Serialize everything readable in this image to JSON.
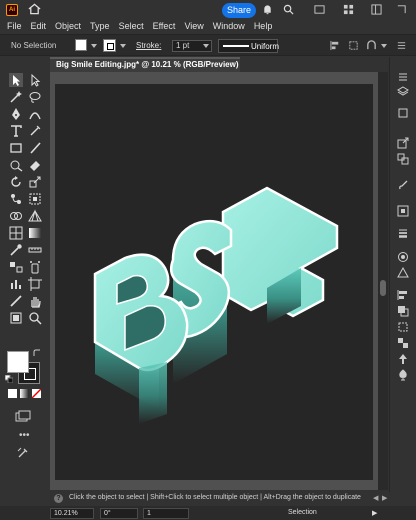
{
  "app": {
    "logo_text": "Ai",
    "share_label": "Share"
  },
  "menu": [
    "File",
    "Edit",
    "Object",
    "Type",
    "Select",
    "Effect",
    "View",
    "Window",
    "Help"
  ],
  "control_bar": {
    "selection_status": "No Selection",
    "stroke_label": "Stroke:",
    "stroke_weight": "1 pt",
    "stroke_profile": "Uniform"
  },
  "document": {
    "tab_title": "Big Smile Editing.jpg* @ 10.21 % (RGB/Preview)",
    "close_glyph": "×",
    "artwork_colors": {
      "face": "#8ee6d8",
      "side_top": "#55c2b3",
      "side_bottom": "#262626",
      "outline": "#ffffff"
    }
  },
  "status": {
    "help_glyph": "?",
    "message": "Click the object to select | Shift+Click to select multiple object | Alt+Drag the object to duplicate"
  },
  "bottom": {
    "zoom": "10.21%",
    "rotation": "0°",
    "artboard_number": "1",
    "tool_name": "Selection"
  }
}
